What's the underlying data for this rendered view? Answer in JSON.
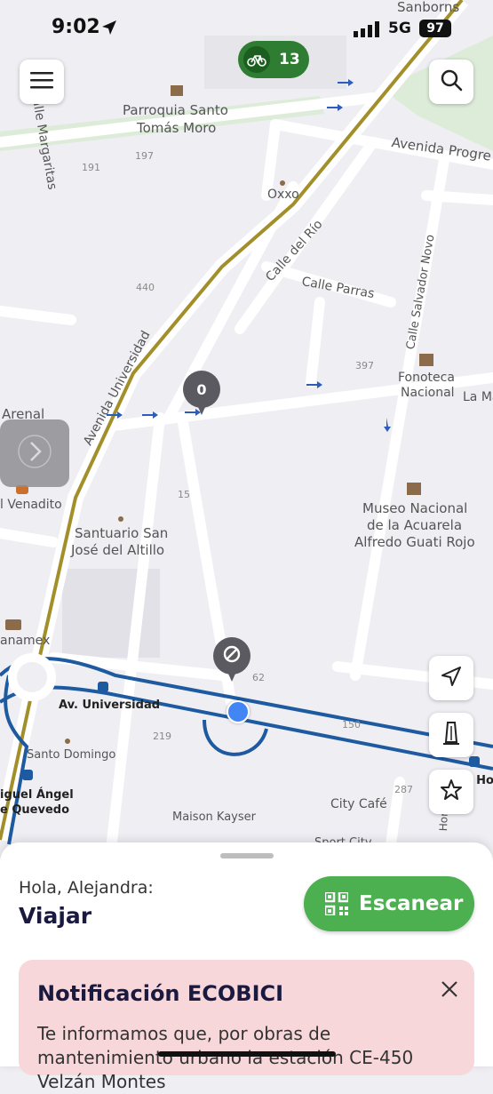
{
  "status_bar": {
    "time": "9:02",
    "network": "5G",
    "battery": "97"
  },
  "map": {
    "labels": {
      "sanborns": "Sanborns",
      "calle_margaritas": "Calle Margaritas",
      "parroquia_1": "Parroquia Santo",
      "parroquia_2": "Tomás Moro",
      "avenida_progreso": "Avenida Progre",
      "oxxo": "Oxxo",
      "calle_del_rio": "Calle del Río",
      "calle_parras": "Calle Parras",
      "calle_salvador_novo": "Calle Salvador Novo",
      "avenida_universidad": "Avenida Universidad",
      "fonoteca_1": "Fonoteca",
      "fonoteca_2": "Nacional",
      "la_ma": "La Ma",
      "arenal": "Arenal",
      "el_venadito": "l Venadito",
      "santuario_1": "Santuario San",
      "santuario_2": "José del Altillo",
      "museo_1": "Museo Nacional",
      "museo_2": "de la Acuarela",
      "museo_3": "Alfredo Guati Rojo",
      "banamex": "anamex",
      "av_universidad_stop": "Av. Universidad",
      "santo_domingo": "Santo Domingo",
      "miguel_1": "iguel Ángel",
      "miguel_2": "e Quevedo",
      "maison_kayser": "Maison Kayser",
      "city_cafe": "City Café",
      "sport_city": "Sport City",
      "hom": "Hom",
      "c_ho": "C Ho",
      "n191": "191",
      "n197": "197",
      "n440": "440",
      "n397": "397",
      "n15": "15",
      "n62": "62",
      "n150": "150",
      "n219": "219",
      "n287": "287"
    },
    "bike_station_count": "13",
    "pin_1": "0",
    "pin_2_icon": "no-entry-icon"
  },
  "bottom_sheet": {
    "greeting": "Hola, Alejandra:",
    "title": "Viajar",
    "scan_button": "Escanear",
    "notification": {
      "title": "Notificación ECOBICI",
      "body": "Te informamos que, por obras de mantenimiento urbano la estación CE-450 Velzán Montes"
    }
  },
  "colors": {
    "accent_green": "#4caf50",
    "bike_pill": "#2e7d32",
    "notice_bg": "#f8d7da",
    "route_blue": "#1e5aa0",
    "metro_line": "#a38f2a"
  }
}
